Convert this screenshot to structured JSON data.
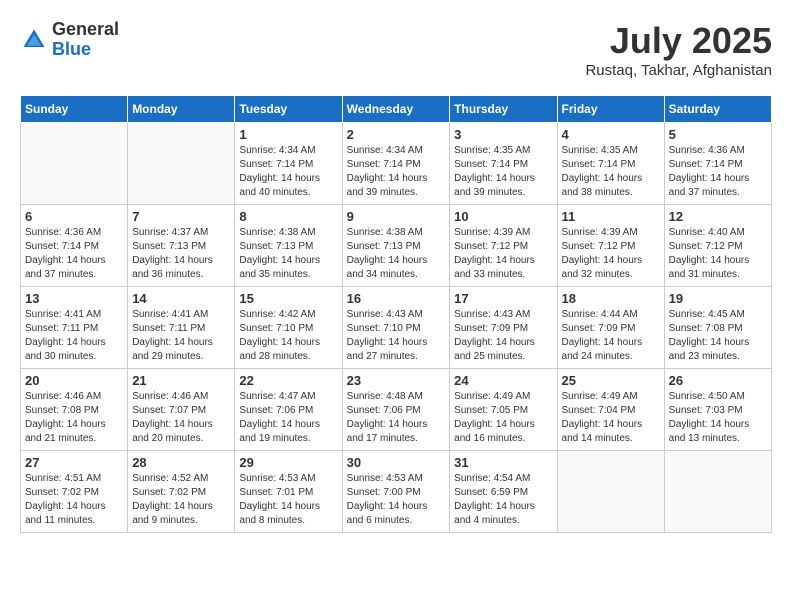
{
  "logo": {
    "general": "General",
    "blue": "Blue"
  },
  "title": {
    "month_year": "July 2025",
    "location": "Rustaq, Takhar, Afghanistan"
  },
  "days_of_week": [
    "Sunday",
    "Monday",
    "Tuesday",
    "Wednesday",
    "Thursday",
    "Friday",
    "Saturday"
  ],
  "weeks": [
    [
      {
        "day": "",
        "info": ""
      },
      {
        "day": "",
        "info": ""
      },
      {
        "day": "1",
        "info": "Sunrise: 4:34 AM\nSunset: 7:14 PM\nDaylight: 14 hours\nand 40 minutes."
      },
      {
        "day": "2",
        "info": "Sunrise: 4:34 AM\nSunset: 7:14 PM\nDaylight: 14 hours\nand 39 minutes."
      },
      {
        "day": "3",
        "info": "Sunrise: 4:35 AM\nSunset: 7:14 PM\nDaylight: 14 hours\nand 39 minutes."
      },
      {
        "day": "4",
        "info": "Sunrise: 4:35 AM\nSunset: 7:14 PM\nDaylight: 14 hours\nand 38 minutes."
      },
      {
        "day": "5",
        "info": "Sunrise: 4:36 AM\nSunset: 7:14 PM\nDaylight: 14 hours\nand 37 minutes."
      }
    ],
    [
      {
        "day": "6",
        "info": "Sunrise: 4:36 AM\nSunset: 7:14 PM\nDaylight: 14 hours\nand 37 minutes."
      },
      {
        "day": "7",
        "info": "Sunrise: 4:37 AM\nSunset: 7:13 PM\nDaylight: 14 hours\nand 36 minutes."
      },
      {
        "day": "8",
        "info": "Sunrise: 4:38 AM\nSunset: 7:13 PM\nDaylight: 14 hours\nand 35 minutes."
      },
      {
        "day": "9",
        "info": "Sunrise: 4:38 AM\nSunset: 7:13 PM\nDaylight: 14 hours\nand 34 minutes."
      },
      {
        "day": "10",
        "info": "Sunrise: 4:39 AM\nSunset: 7:12 PM\nDaylight: 14 hours\nand 33 minutes."
      },
      {
        "day": "11",
        "info": "Sunrise: 4:39 AM\nSunset: 7:12 PM\nDaylight: 14 hours\nand 32 minutes."
      },
      {
        "day": "12",
        "info": "Sunrise: 4:40 AM\nSunset: 7:12 PM\nDaylight: 14 hours\nand 31 minutes."
      }
    ],
    [
      {
        "day": "13",
        "info": "Sunrise: 4:41 AM\nSunset: 7:11 PM\nDaylight: 14 hours\nand 30 minutes."
      },
      {
        "day": "14",
        "info": "Sunrise: 4:41 AM\nSunset: 7:11 PM\nDaylight: 14 hours\nand 29 minutes."
      },
      {
        "day": "15",
        "info": "Sunrise: 4:42 AM\nSunset: 7:10 PM\nDaylight: 14 hours\nand 28 minutes."
      },
      {
        "day": "16",
        "info": "Sunrise: 4:43 AM\nSunset: 7:10 PM\nDaylight: 14 hours\nand 27 minutes."
      },
      {
        "day": "17",
        "info": "Sunrise: 4:43 AM\nSunset: 7:09 PM\nDaylight: 14 hours\nand 25 minutes."
      },
      {
        "day": "18",
        "info": "Sunrise: 4:44 AM\nSunset: 7:09 PM\nDaylight: 14 hours\nand 24 minutes."
      },
      {
        "day": "19",
        "info": "Sunrise: 4:45 AM\nSunset: 7:08 PM\nDaylight: 14 hours\nand 23 minutes."
      }
    ],
    [
      {
        "day": "20",
        "info": "Sunrise: 4:46 AM\nSunset: 7:08 PM\nDaylight: 14 hours\nand 21 minutes."
      },
      {
        "day": "21",
        "info": "Sunrise: 4:46 AM\nSunset: 7:07 PM\nDaylight: 14 hours\nand 20 minutes."
      },
      {
        "day": "22",
        "info": "Sunrise: 4:47 AM\nSunset: 7:06 PM\nDaylight: 14 hours\nand 19 minutes."
      },
      {
        "day": "23",
        "info": "Sunrise: 4:48 AM\nSunset: 7:06 PM\nDaylight: 14 hours\nand 17 minutes."
      },
      {
        "day": "24",
        "info": "Sunrise: 4:49 AM\nSunset: 7:05 PM\nDaylight: 14 hours\nand 16 minutes."
      },
      {
        "day": "25",
        "info": "Sunrise: 4:49 AM\nSunset: 7:04 PM\nDaylight: 14 hours\nand 14 minutes."
      },
      {
        "day": "26",
        "info": "Sunrise: 4:50 AM\nSunset: 7:03 PM\nDaylight: 14 hours\nand 13 minutes."
      }
    ],
    [
      {
        "day": "27",
        "info": "Sunrise: 4:51 AM\nSunset: 7:02 PM\nDaylight: 14 hours\nand 11 minutes."
      },
      {
        "day": "28",
        "info": "Sunrise: 4:52 AM\nSunset: 7:02 PM\nDaylight: 14 hours\nand 9 minutes."
      },
      {
        "day": "29",
        "info": "Sunrise: 4:53 AM\nSunset: 7:01 PM\nDaylight: 14 hours\nand 8 minutes."
      },
      {
        "day": "30",
        "info": "Sunrise: 4:53 AM\nSunset: 7:00 PM\nDaylight: 14 hours\nand 6 minutes."
      },
      {
        "day": "31",
        "info": "Sunrise: 4:54 AM\nSunset: 6:59 PM\nDaylight: 14 hours\nand 4 minutes."
      },
      {
        "day": "",
        "info": ""
      },
      {
        "day": "",
        "info": ""
      }
    ]
  ]
}
